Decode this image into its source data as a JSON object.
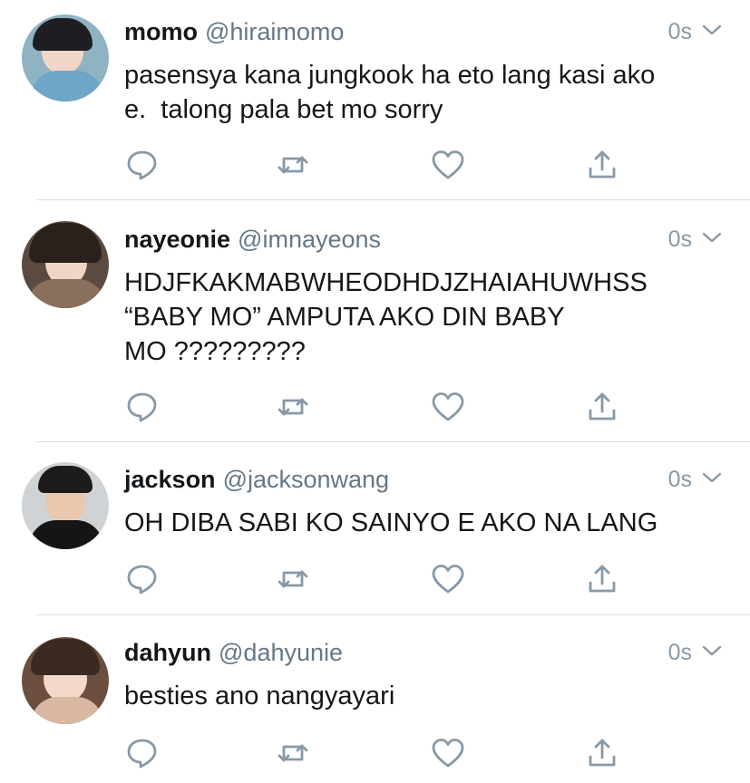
{
  "colors": {
    "icon": "#8899a6",
    "divider": "#d8dde2"
  },
  "tweets": [
    {
      "name": "momo",
      "handle": "@hiraimomo",
      "time": "0s",
      "text": "pasensya kana jungkook ha eto lang kasi ako\ne.  talong pala bet mo sorry"
    },
    {
      "name": "nayeonie",
      "handle": "@imnayeons",
      "time": "0s",
      "text": "HDJFKAKMABWHEODHDJZHAIAHUWHSS\n“BABY MO” AMPUTA AKO DIN BABY\nMO ?????????"
    },
    {
      "name": "jackson",
      "handle": "@jacksonwang",
      "time": "0s",
      "text": "OH DIBA SABI KO SAINYO E AKO NA LANG"
    },
    {
      "name": "dahyun",
      "handle": "@dahyunie",
      "time": "0s",
      "text": "besties ano nangyayari"
    }
  ],
  "icons": [
    "reply-icon",
    "retweet-icon",
    "like-icon",
    "share-icon",
    "chevron-down-icon"
  ]
}
